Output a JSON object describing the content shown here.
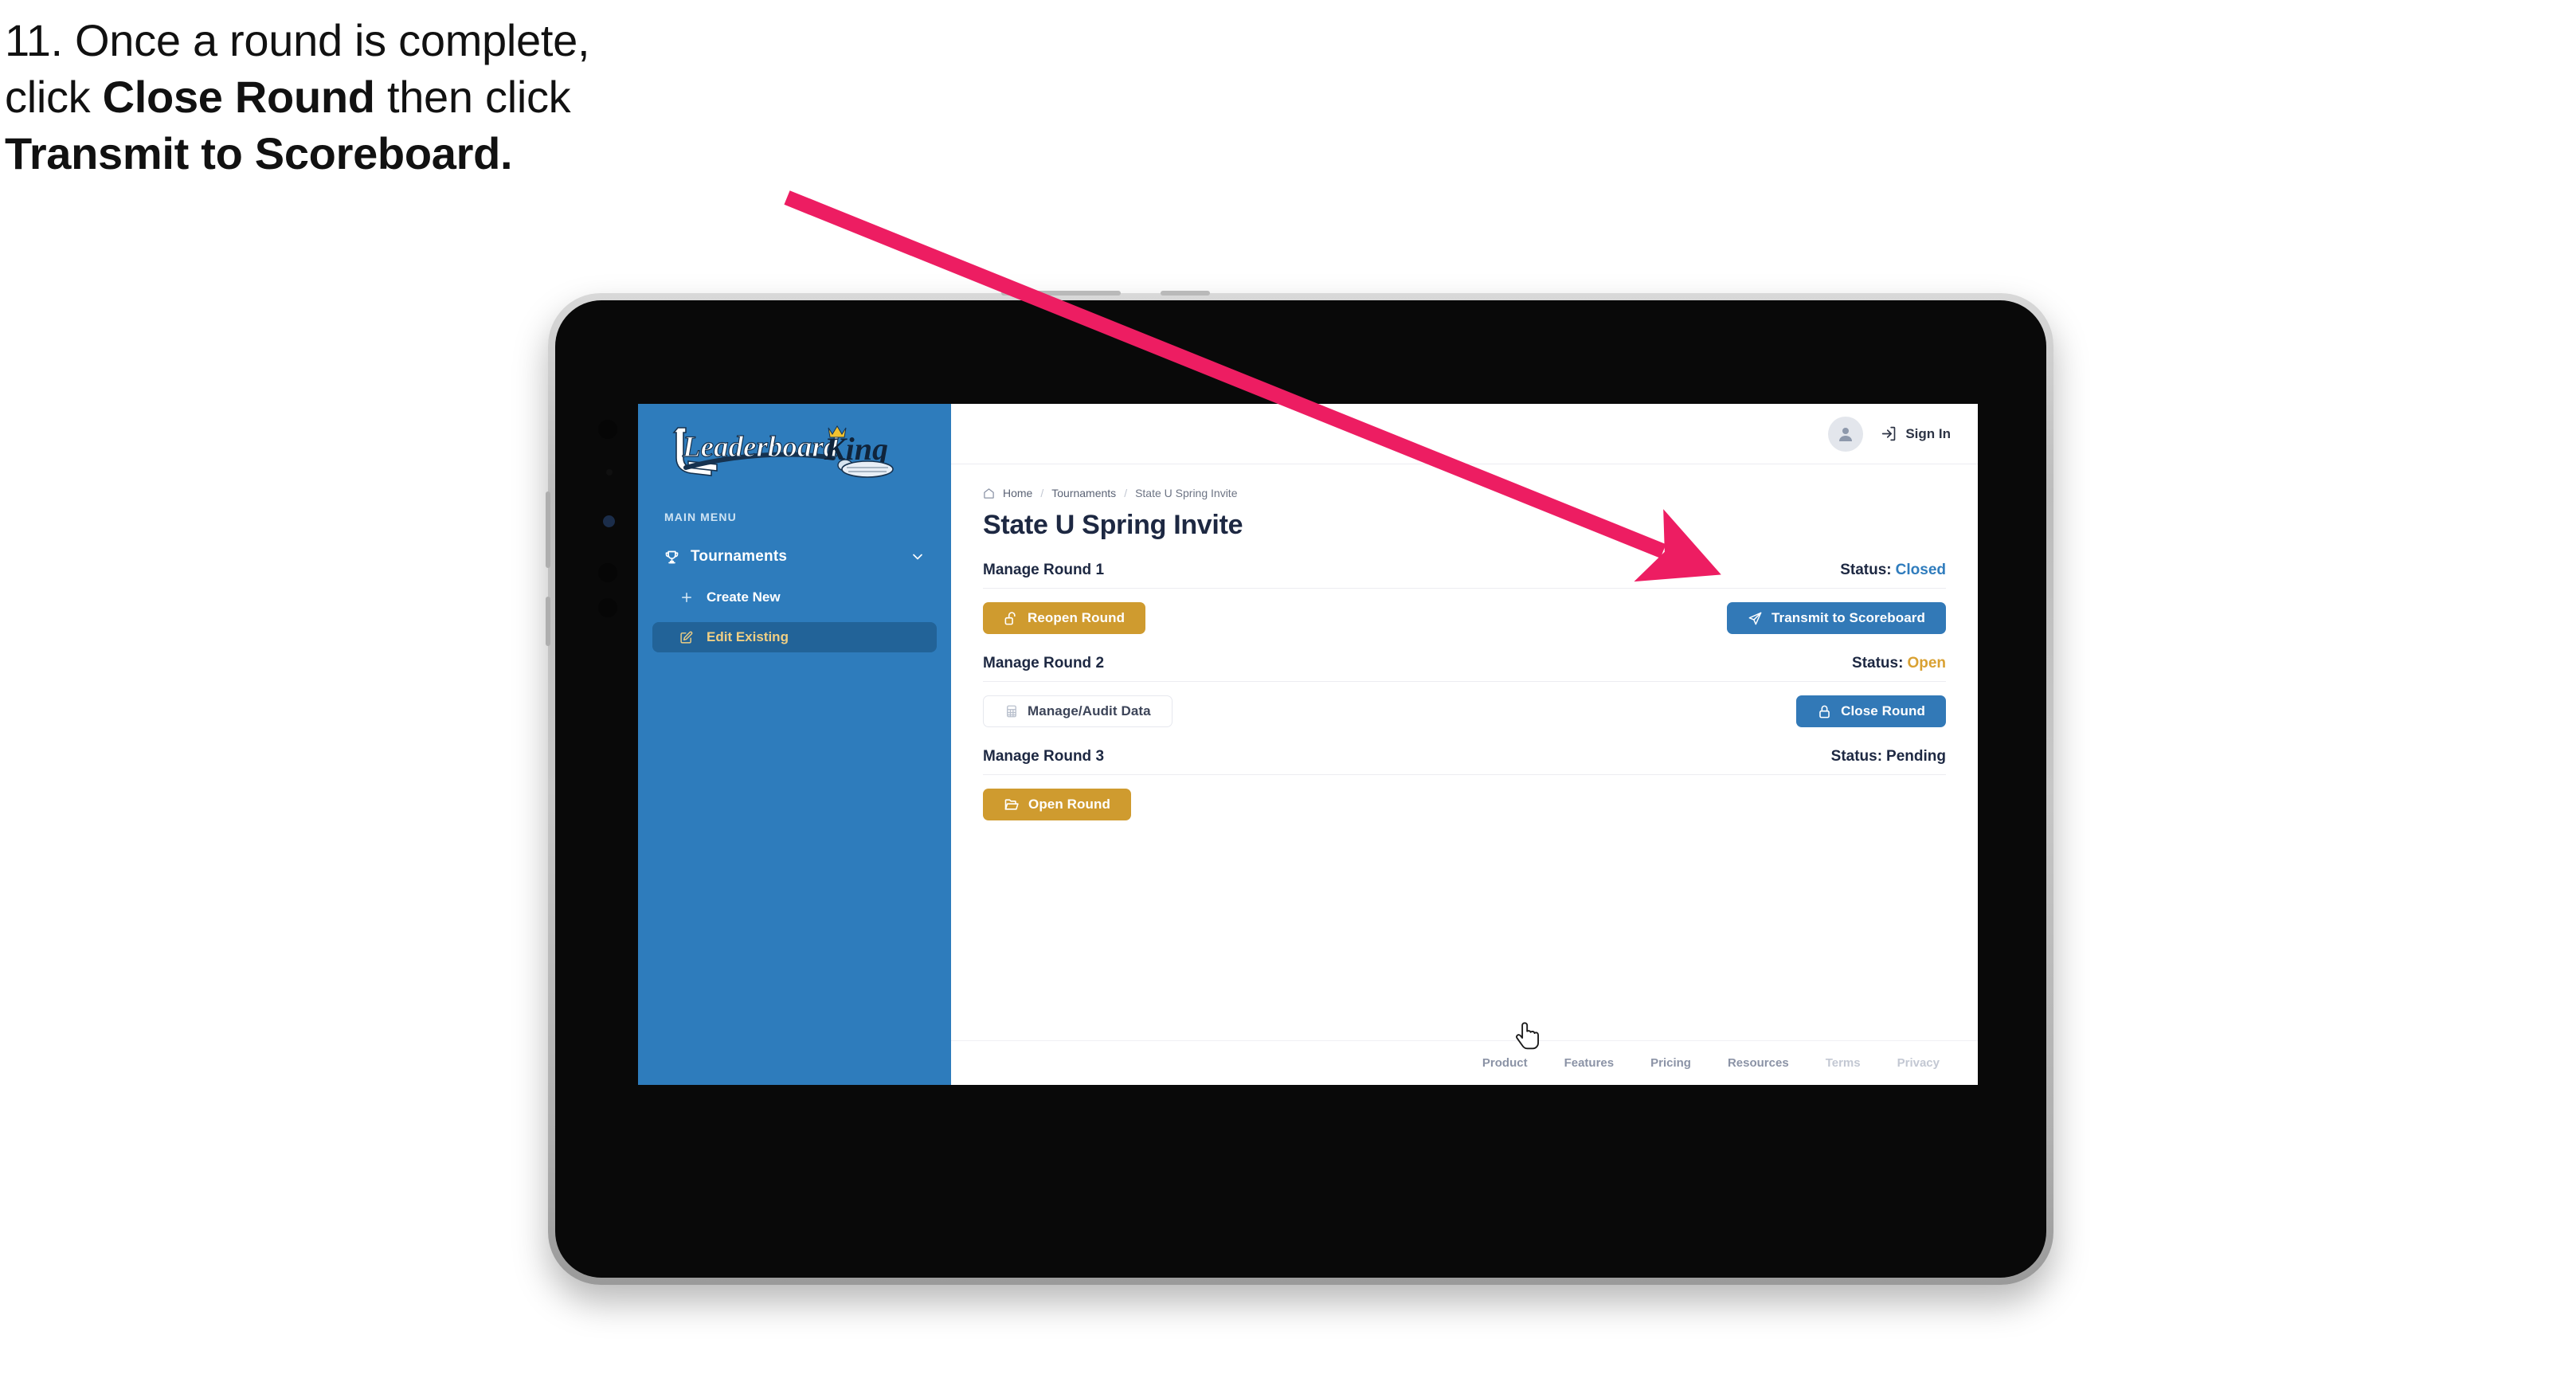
{
  "caption": {
    "line1": "11. Once a round is complete,",
    "line2_a": "click ",
    "line2_b": "Close Round",
    "line2_c": " then click",
    "line3": "Transmit to Scoreboard."
  },
  "annotation": {
    "arrow_color": "#ed1d62",
    "points_to": "Transmit to Scoreboard"
  },
  "sidebar": {
    "logo_text": "LeaderboardKing",
    "logo_word_1": "Leaderboard",
    "logo_word_2": "King",
    "section_label": "MAIN MENU",
    "nav": [
      {
        "label": "Tournaments",
        "icon": "trophy-icon",
        "chevron": "chevron-down-icon",
        "expanded": true
      }
    ],
    "sub_items": [
      {
        "label": "Create New",
        "icon": "plus-icon",
        "active": false
      },
      {
        "label": "Edit Existing",
        "icon": "pencil-square-icon",
        "active": true
      }
    ],
    "bg_color": "#2e7cbc",
    "active_bg_color": "#226398",
    "active_text_color": "#f0cf84"
  },
  "topbar": {
    "avatar_icon": "user-avatar-icon",
    "signin_icon": "login-arrow-icon",
    "signin_label": "Sign In"
  },
  "breadcrumb": {
    "home_icon": "home-icon",
    "items": [
      "Home",
      "Tournaments",
      "State U Spring Invite"
    ],
    "separator": "/"
  },
  "page_title": "State U Spring Invite",
  "rounds": [
    {
      "name": "Manage Round 1",
      "status_label": "Status:",
      "status_value": "Closed",
      "status_class": "closed",
      "left_button": {
        "label": "Reopen Round",
        "icon": "unlock-icon",
        "style": "gold"
      },
      "right_button": {
        "label": "Transmit to Scoreboard",
        "icon": "send-plane-icon",
        "style": "blue"
      }
    },
    {
      "name": "Manage Round 2",
      "status_label": "Status:",
      "status_value": "Open",
      "status_class": "open",
      "left_button": {
        "label": "Manage/Audit Data",
        "icon": "table-grid-icon",
        "style": "ghost"
      },
      "right_button": {
        "label": "Close Round",
        "icon": "lock-icon",
        "style": "blue"
      }
    },
    {
      "name": "Manage Round 3",
      "status_label": "Status:",
      "status_value": "Pending",
      "status_class": "pending",
      "left_button": {
        "label": "Open Round",
        "icon": "open-folder-icon",
        "style": "gold"
      },
      "right_button": null
    }
  ],
  "footer": {
    "links": [
      {
        "label": "Product",
        "dim": false
      },
      {
        "label": "Features",
        "dim": false
      },
      {
        "label": "Pricing",
        "dim": false
      },
      {
        "label": "Resources",
        "dim": false
      },
      {
        "label": "Terms",
        "dim": true
      },
      {
        "label": "Privacy",
        "dim": true
      }
    ]
  },
  "cursor": {
    "icon": "pointing-hand-cursor"
  },
  "colors": {
    "brand_blue": "#2e7cbc",
    "button_blue": "#3279b7",
    "gold": "#cf9b2f",
    "status_open": "#d9a132",
    "status_closed": "#2f7cbd",
    "ink": "#1d2842",
    "annotation_pink": "#ed1d62"
  }
}
